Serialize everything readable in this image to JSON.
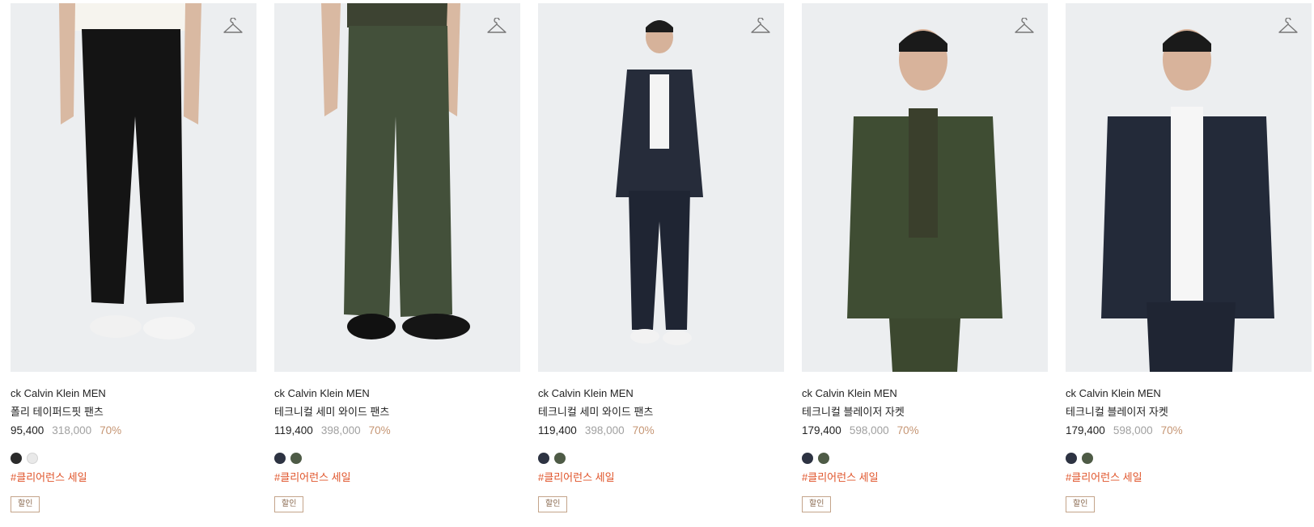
{
  "products": [
    {
      "brand": "ck Calvin Klein MEN",
      "name": "폴리 테이퍼드핏 팬츠",
      "sale_price": "95,400",
      "original_price": "318,000",
      "discount": "70%",
      "colors": [
        "#2b2b2b",
        "#e9e9e9"
      ],
      "tag": "#클리어런스 세일",
      "badge": "할인",
      "image": "black-pants-white-sneakers"
    },
    {
      "brand": "ck Calvin Klein MEN",
      "name": "테크니컬 세미 와이드 팬츠",
      "sale_price": "119,400",
      "original_price": "398,000",
      "discount": "70%",
      "colors": [
        "#2d3342",
        "#4e5b46"
      ],
      "tag": "#클리어런스 세일",
      "badge": "할인",
      "image": "olive-pants-black-shoes"
    },
    {
      "brand": "ck Calvin Klein MEN",
      "name": "테크니컬 세미 와이드 팬츠",
      "sale_price": "119,400",
      "original_price": "398,000",
      "discount": "70%",
      "colors": [
        "#2d3342",
        "#4e5b46"
      ],
      "tag": "#클리어런스 세일",
      "badge": "할인",
      "image": "navy-suit-full-body"
    },
    {
      "brand": "ck Calvin Klein MEN",
      "name": "테크니컬 블레이저 자켓",
      "sale_price": "179,400",
      "original_price": "598,000",
      "discount": "70%",
      "colors": [
        "#2d3342",
        "#4e5b46"
      ],
      "tag": "#클리어런스 세일",
      "badge": "할인",
      "image": "olive-blazer"
    },
    {
      "brand": "ck Calvin Klein MEN",
      "name": "테크니컬 블레이저 자켓",
      "sale_price": "179,400",
      "original_price": "598,000",
      "discount": "70%",
      "colors": [
        "#2d3342",
        "#4e5b46"
      ],
      "tag": "#클리어런스 세일",
      "badge": "할인",
      "image": "navy-blazer"
    }
  ],
  "icons": {
    "wishlist": "hanger-icon"
  }
}
